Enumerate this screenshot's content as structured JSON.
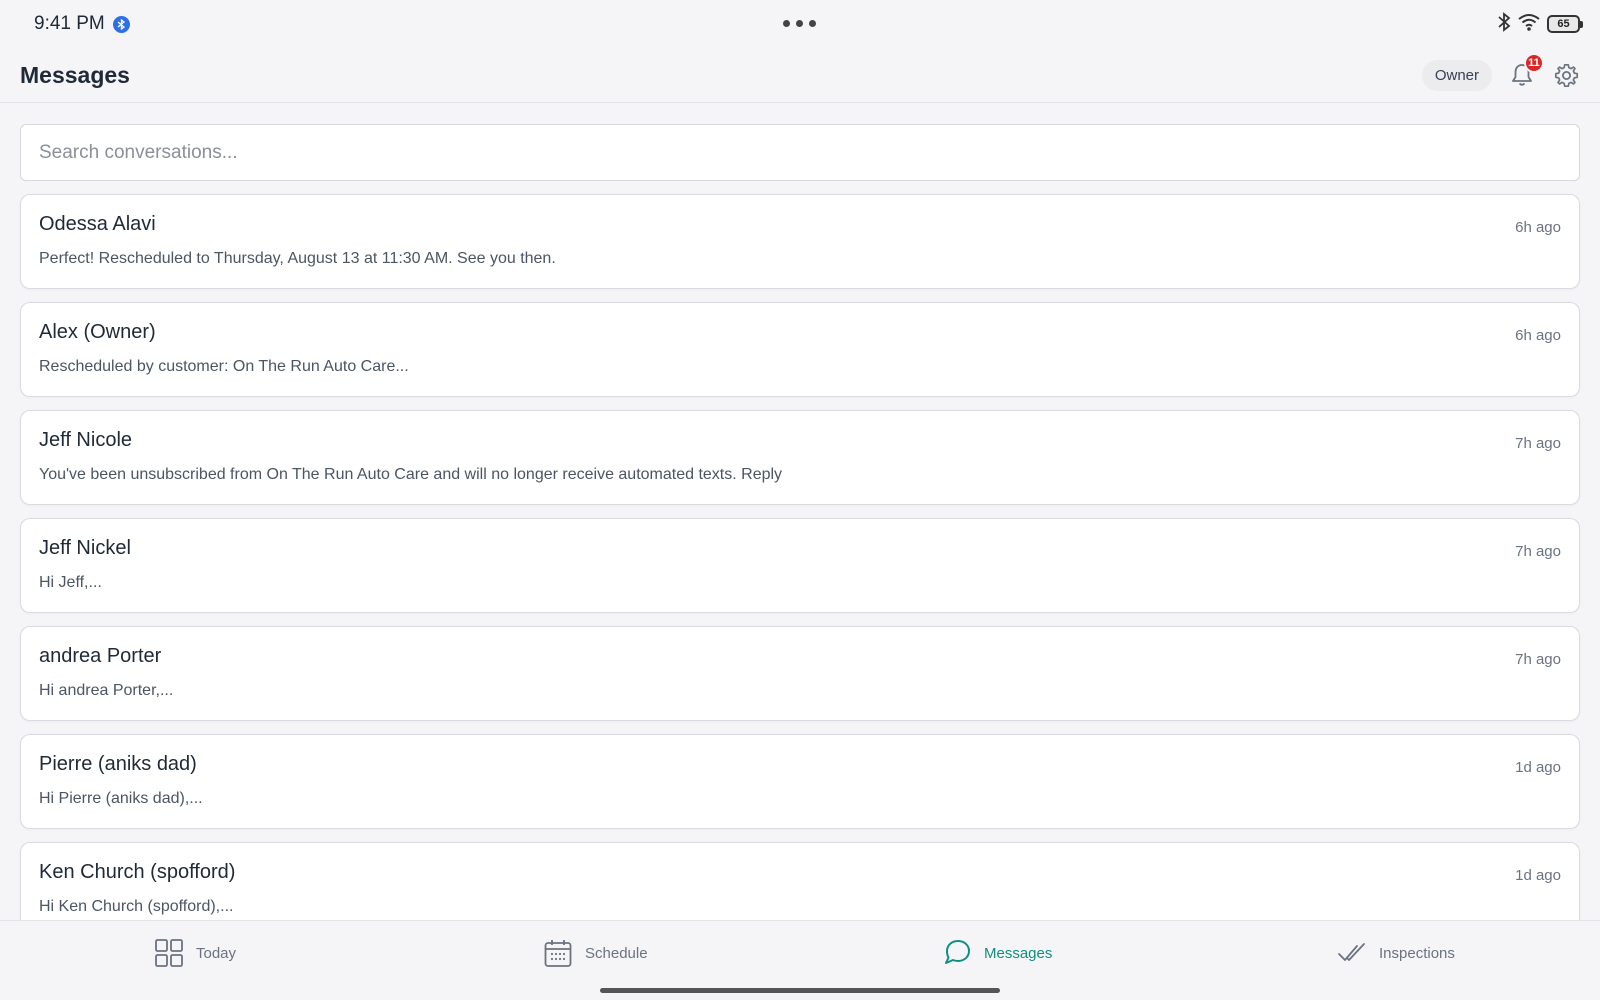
{
  "status_bar": {
    "time": "9:41 PM",
    "battery": "65",
    "icons": [
      "bluetooth-icon",
      "wifi-icon",
      "battery-icon"
    ]
  },
  "header": {
    "title": "Messages",
    "role": "Owner",
    "notification_count": "11"
  },
  "search": {
    "placeholder": "Search conversations..."
  },
  "conversations": [
    {
      "name": "Odessa Alavi",
      "preview": "Perfect! Rescheduled to Thursday, August 13 at 11:30 AM. See you then.",
      "time": "6h ago"
    },
    {
      "name": "Alex (Owner)",
      "preview": "Rescheduled by customer: On The Run Auto Care...",
      "time": "6h ago"
    },
    {
      "name": "Jeff Nicole",
      "preview": "You've been unsubscribed from On The Run Auto Care and will no longer receive automated texts. Reply",
      "time": "7h ago"
    },
    {
      "name": "Jeff Nickel",
      "preview": "Hi Jeff,...",
      "time": "7h ago"
    },
    {
      "name": "andrea Porter",
      "preview": "Hi andrea Porter,...",
      "time": "7h ago"
    },
    {
      "name": "Pierre (aniks dad)",
      "preview": "Hi Pierre (aniks dad),...",
      "time": "1d ago"
    },
    {
      "name": "Ken Church (spofford)",
      "preview": "Hi Ken Church (spofford),...",
      "time": "1d ago"
    }
  ],
  "tabs": [
    {
      "label": "Today",
      "icon": "grid-icon"
    },
    {
      "label": "Schedule",
      "icon": "calendar-icon"
    },
    {
      "label": "Messages",
      "icon": "chat-bubble-icon",
      "active": true
    },
    {
      "label": "Inspections",
      "icon": "double-check-icon"
    }
  ],
  "colors": {
    "accent": "#0f8f7e",
    "badge": "#dc2626",
    "bluetooth_dot": "#2f6fe4"
  }
}
